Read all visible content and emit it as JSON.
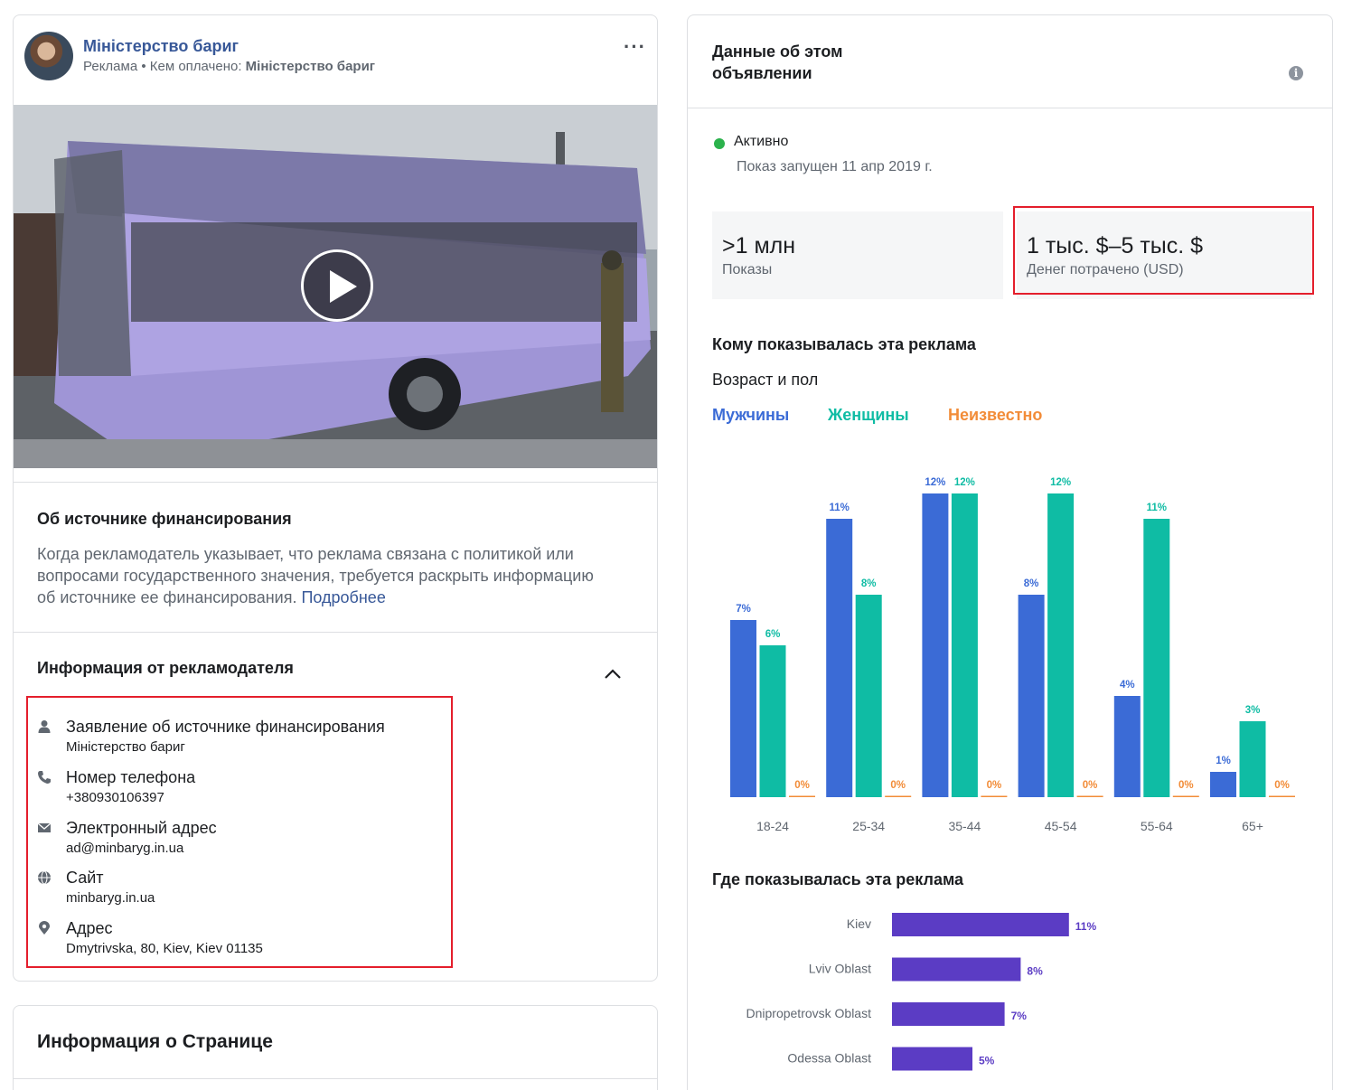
{
  "post": {
    "page_name": "Міністерство бариг",
    "sponsor_prefix": "Реклама • Кем оплачено: ",
    "sponsor_name": "Міністерство бариг",
    "more": "···"
  },
  "funding": {
    "title": "Об источнике финансирования",
    "line1": "Когда рекламодатель указывает, что реклама связана с политикой или",
    "line2": "вопросами государственного значения, требуется раскрыть информацию",
    "line3": "об источнике ее финансирования.",
    "more_link": "Подробнее"
  },
  "advertiser": {
    "title": "Информация от рекламодателя",
    "items": [
      {
        "label": "Заявление об источнике финансирования",
        "value": "Міністерство бариг",
        "icon": "person-icon"
      },
      {
        "label": "Номер телефона",
        "value": "+380930106397",
        "icon": "phone-icon"
      },
      {
        "label": "Электронный адрес",
        "value": "ad@minbaryg.in.ua",
        "icon": "envelope-icon"
      },
      {
        "label": "Сайт",
        "value": "minbaryg.in.ua",
        "icon": "globe-icon"
      },
      {
        "label": "Адрес",
        "value": "Dmytrivska, 80, Kiev, Kiev 01135",
        "icon": "location-pin-icon"
      }
    ]
  },
  "page_info": {
    "title": "Информация о Странице"
  },
  "ad_data": {
    "title": "Данные об этом объявлении",
    "status": "Активно",
    "started": "Показ запущен 11 апр 2019 г.",
    "impressions_value": ">1 млн",
    "impressions_label": "Показы",
    "spend_value": "1 тыс. $–5 тыс. $",
    "spend_label": "Денег потрачено (USD)",
    "audience_title": "Кому показывалась эта реклама",
    "age_gender_title": "Возраст и пол",
    "legend_men": "Мужчины",
    "legend_women": "Женщины",
    "legend_unknown": "Неизвестно",
    "where_title": "Где показывалась эта реклама"
  },
  "colors": {
    "men": "#3b6bd6",
    "women": "#0fbca4",
    "unknown": "#f28c38",
    "region": "#5b3cc4",
    "link": "#385898",
    "status_active": "#2bb24c",
    "highlight": "#e41e2c"
  },
  "chart_data": [
    {
      "type": "bar",
      "categories": [
        "18-24",
        "25-34",
        "35-44",
        "45-54",
        "55-64",
        "65+"
      ],
      "series": [
        {
          "name": "Мужчины",
          "values": [
            7,
            11,
            12,
            8,
            4,
            1
          ]
        },
        {
          "name": "Женщины",
          "values": [
            6,
            8,
            12,
            12,
            11,
            3
          ]
        },
        {
          "name": "Неизвестно",
          "values": [
            0,
            0,
            0,
            0,
            0,
            0
          ]
        }
      ],
      "value_suffix": "%",
      "ylim": [
        0,
        12
      ]
    },
    {
      "type": "bar",
      "orientation": "horizontal",
      "categories": [
        "Kiev",
        "Lviv Oblast",
        "Dnipropetrovsk Oblast",
        "Odessa Oblast"
      ],
      "values": [
        11,
        8,
        7,
        5
      ],
      "value_suffix": "%"
    }
  ]
}
